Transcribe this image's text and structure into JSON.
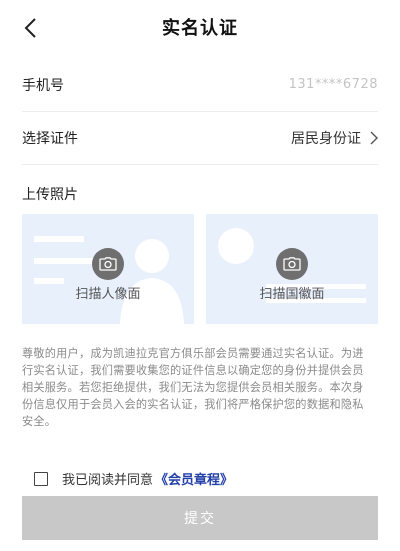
{
  "header": {
    "title": "实名认证",
    "back_icon": "chevron-left-icon"
  },
  "form": {
    "phone": {
      "label": "手机号",
      "value": "131****6728"
    },
    "id_type": {
      "label": "选择证件",
      "value": "居民身份证",
      "icon": "chevron-right-icon"
    }
  },
  "upload": {
    "label": "上传照片",
    "cards": [
      {
        "label": "扫描人像面",
        "icon": "camera-icon"
      },
      {
        "label": "扫描国徽面",
        "icon": "camera-icon"
      }
    ]
  },
  "notice": "尊敬的用户，成为凯迪拉克官方俱乐部会员需要通过实名认证。为进行实名认证，我们需要收集您的证件信息以确定您的身份并提供会员相关服务。若您拒绝提供，我们无法为您提供会员相关服务。本次身份信息仅用于会员入会的实名认证，我们将严格保护您的数据和隐私安全。",
  "agreement": {
    "text": "我已阅读并同意",
    "link": "《会员章程》",
    "checked": false
  },
  "submit_label": "提交",
  "colors": {
    "card_bg": "#e8f0fc",
    "link": "#2240a8",
    "submit_bg": "#c8c8c8",
    "placeholder": "#c4c4c4"
  }
}
